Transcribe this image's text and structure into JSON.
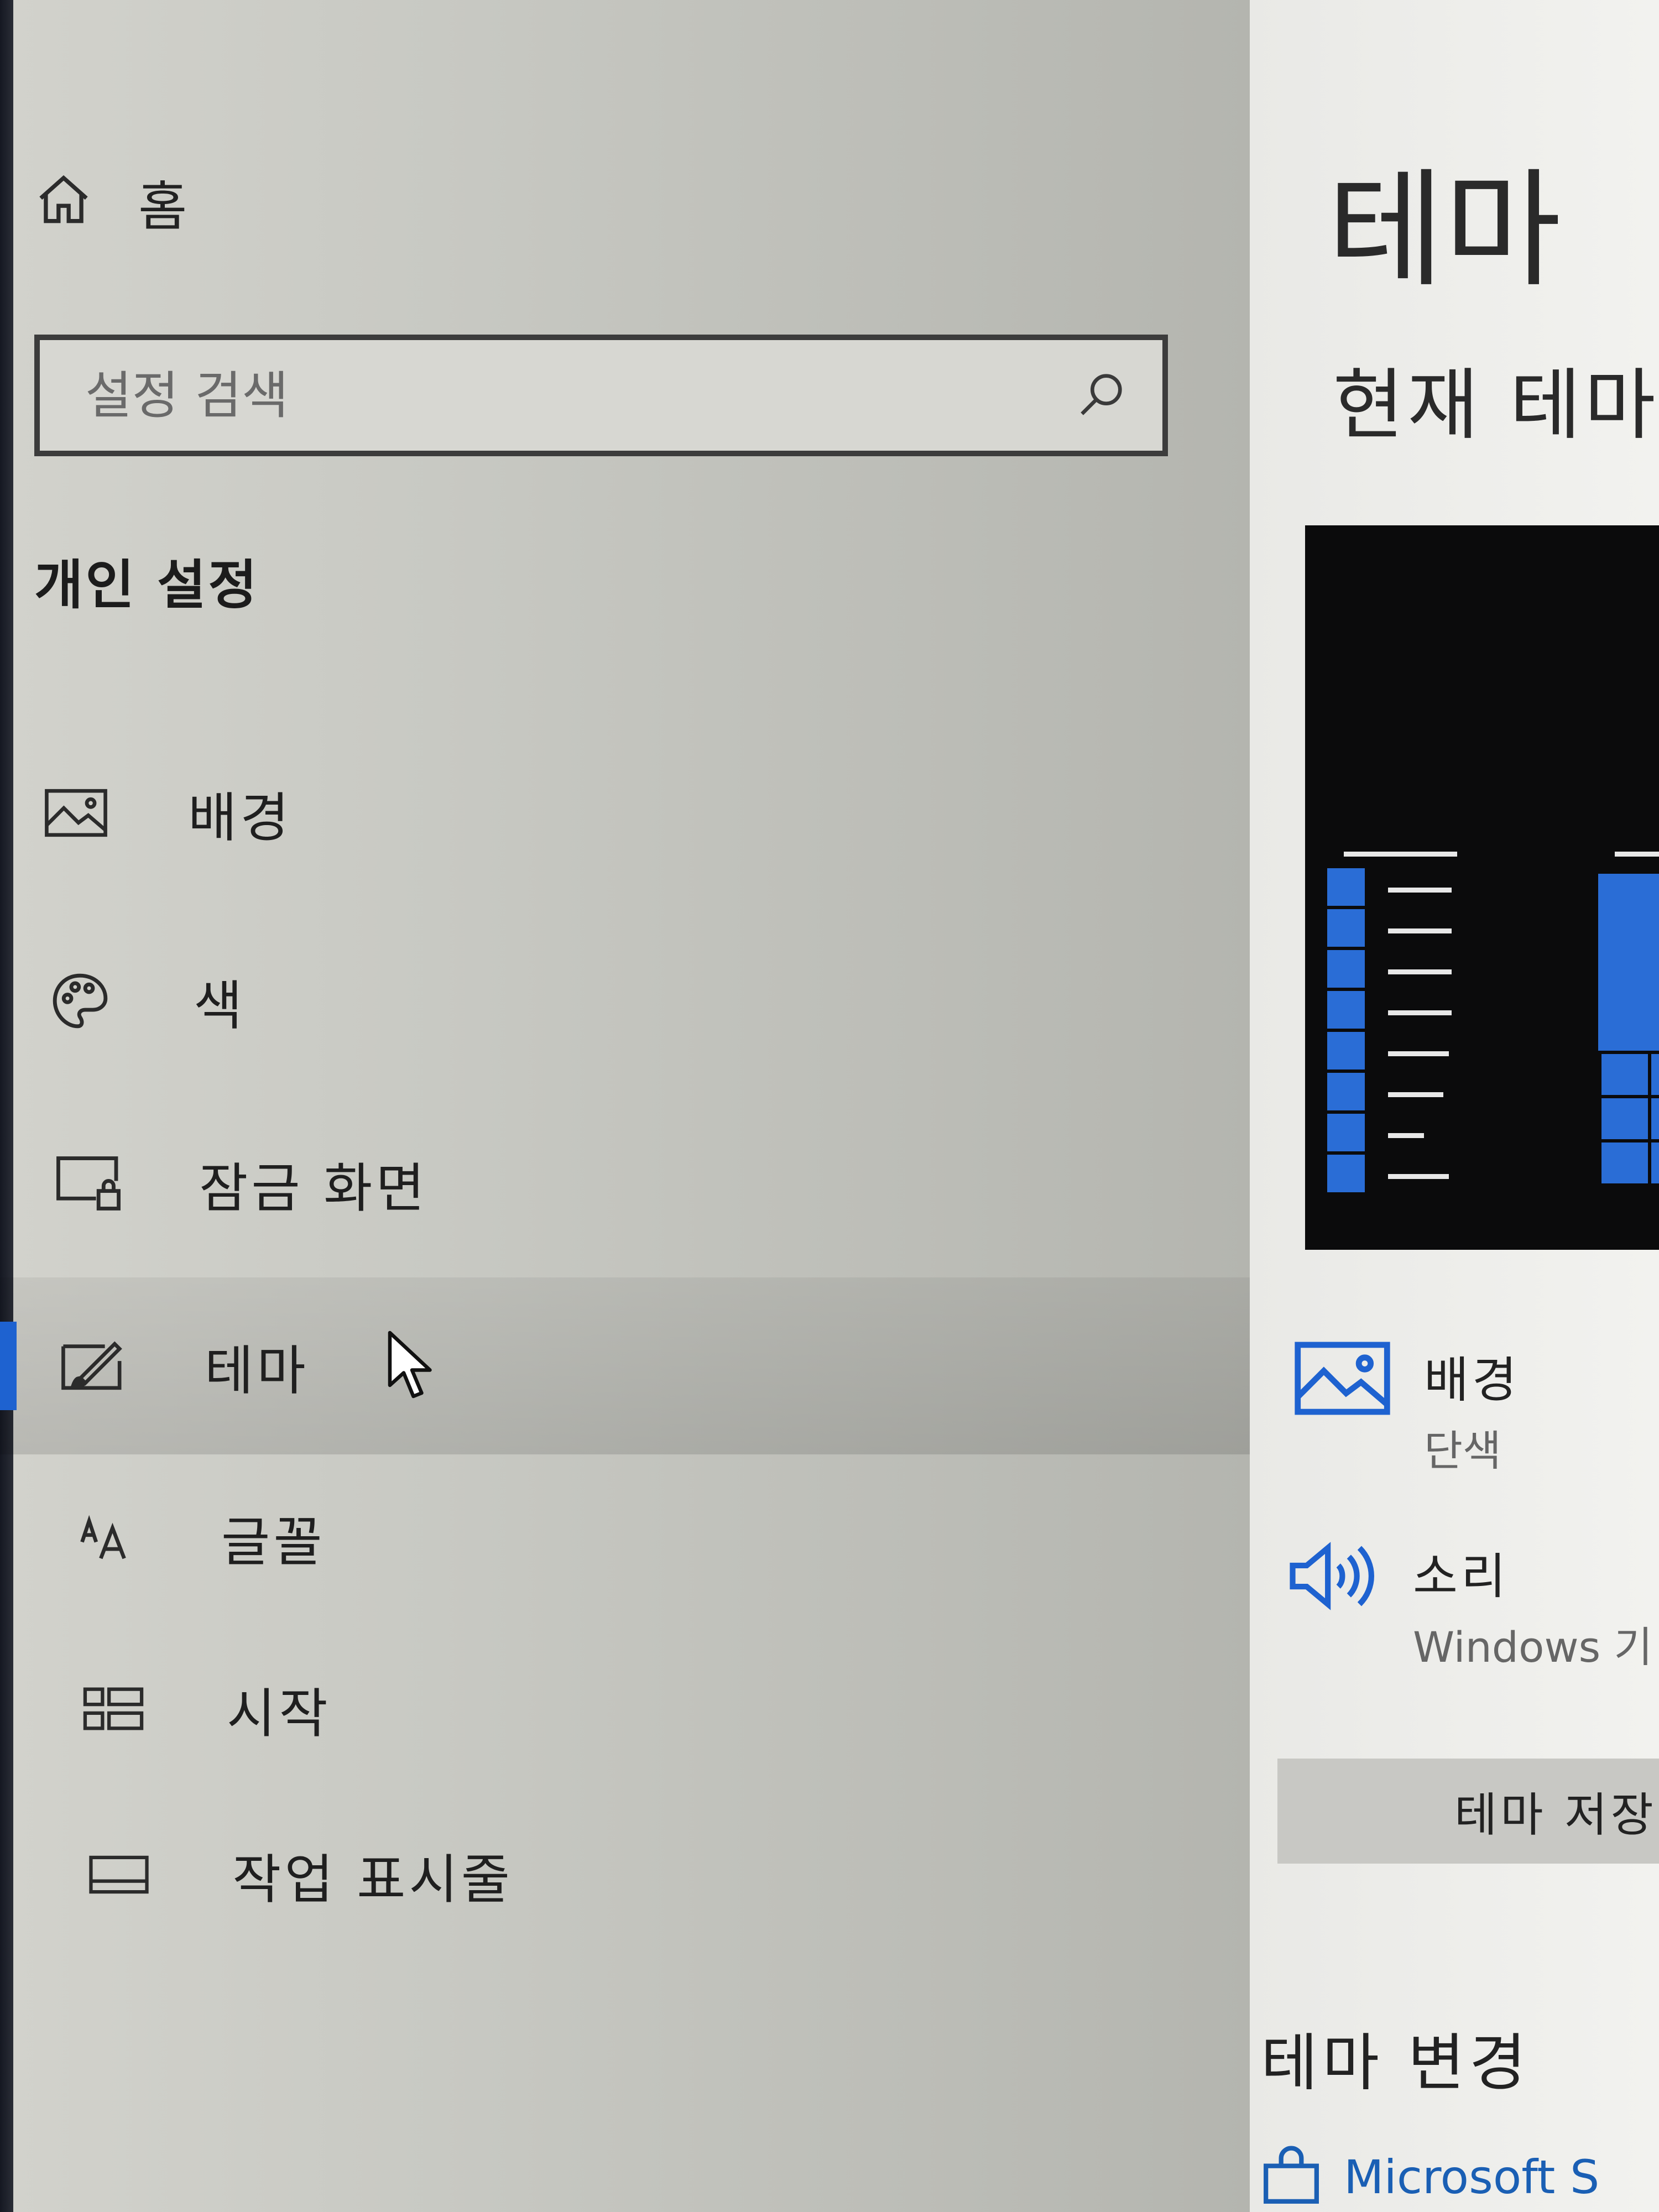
{
  "sidebar": {
    "home_label": "홈",
    "search_placeholder": "설정 검색",
    "section_title": "개인 설정",
    "items": [
      {
        "label": "배경",
        "icon": "image-icon"
      },
      {
        "label": "색",
        "icon": "palette-icon"
      },
      {
        "label": "잠금 화면",
        "icon": "lock-screen-icon"
      },
      {
        "label": "테마",
        "icon": "theme-brush-icon",
        "active": true
      },
      {
        "label": "글꼴",
        "icon": "font-icon"
      },
      {
        "label": "시작",
        "icon": "start-icon"
      },
      {
        "label": "작업 표시줄",
        "icon": "taskbar-icon"
      }
    ]
  },
  "main": {
    "title": "테마",
    "current_theme_heading": "현재 테마",
    "settings": [
      {
        "title": "배경",
        "value": "단색",
        "icon": "image-icon"
      },
      {
        "title": "소리",
        "value": "Windows 기",
        "icon": "speaker-icon"
      }
    ],
    "save_button_label": "테마 저장",
    "change_theme_heading": "테마 변경",
    "store_link_label": "Microsoft S"
  },
  "colors": {
    "accent": "#1e62d0",
    "tile_blue": "#2a6dd6",
    "preview_bg": "#0b0b0c"
  }
}
